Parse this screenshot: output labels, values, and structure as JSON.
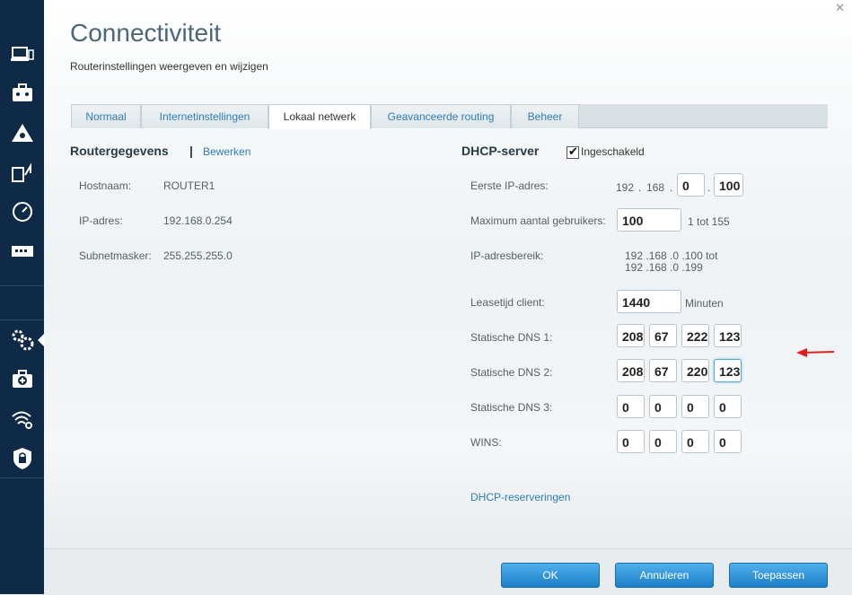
{
  "page": {
    "title": "Connectiviteit",
    "subtitle": "Routerinstellingen weergeven en wijzigen"
  },
  "sidebar": {
    "items": [
      {
        "icon": "computer-icon"
      },
      {
        "icon": "toolbox-icon"
      },
      {
        "icon": "network-map-icon"
      },
      {
        "icon": "external-storage-icon"
      },
      {
        "icon": "speed-test-icon"
      },
      {
        "icon": "usb-icon"
      },
      {
        "icon": "connectivity-gear-icon"
      },
      {
        "icon": "troubleshooting-icon"
      },
      {
        "icon": "wireless-icon"
      },
      {
        "icon": "security-icon"
      }
    ]
  },
  "tabs": [
    {
      "label": "Normaal"
    },
    {
      "label": "Internetinstellingen"
    },
    {
      "label": "Lokaal netwerk"
    },
    {
      "label": "Geavanceerde routing"
    },
    {
      "label": "Beheer"
    }
  ],
  "router": {
    "heading": "Routergegevens",
    "separator": "|",
    "edit_link": "Bewerken",
    "hostname_label": "Hostnaam:",
    "hostname": "ROUTER1",
    "ip_label": "IP-adres:",
    "ip": "192.168.0.254",
    "subnet_label": "Subnetmasker:",
    "subnet": "255.255.255.0"
  },
  "dhcp": {
    "heading": "DHCP-server",
    "enabled_label": "Ingeschakeld",
    "enabled": true,
    "first_ip_label": "Eerste IP-adres:",
    "first_ip_1": "192",
    "first_ip_2": "168",
    "first_ip_3": "0",
    "first_ip_4": "100",
    "max_users_label": "Maximum aantal gebruikers:",
    "max_users": "100",
    "max_users_range": "1 tot 155",
    "range_label": "IP-adresbereik:",
    "range_line1": "192 .168 .0 .100  tot",
    "range_line2": "192 .168 .0 .199",
    "lease_label": "Leasetijd client:",
    "lease": "1440",
    "lease_unit": "Minuten",
    "dns1_label": "Statische DNS 1:",
    "dns1": [
      "208",
      "67",
      "222",
      "123"
    ],
    "dns2_label": "Statische DNS 2:",
    "dns2": [
      "208",
      "67",
      "220",
      "123"
    ],
    "dns3_label": "Statische DNS 3:",
    "dns3": [
      "0",
      "0",
      "0",
      "0"
    ],
    "wins_label": "WINS:",
    "wins": [
      "0",
      "0",
      "0",
      "0"
    ],
    "reservations_link": "DHCP-reserveringen"
  },
  "buttons": {
    "ok": "OK",
    "cancel": "Annuleren",
    "apply": "Toepassen"
  },
  "colors": {
    "sidebar": "#0e2a47",
    "accent": "#2f7db9",
    "annotation_arrow": "#e02020"
  }
}
